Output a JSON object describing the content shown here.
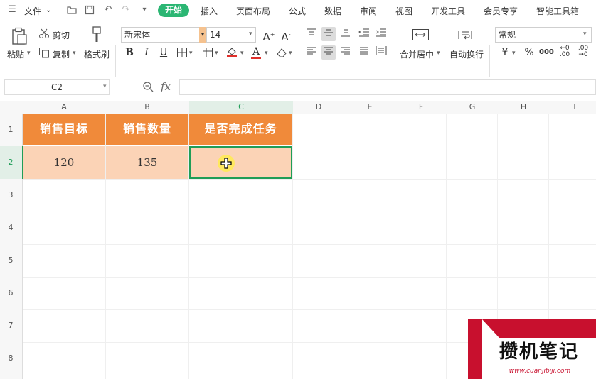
{
  "menubar": {
    "file": "文件",
    "items": [
      "开始",
      "插入",
      "页面布局",
      "公式",
      "数据",
      "审阅",
      "视图",
      "开发工具",
      "会员专享",
      "智能工具箱"
    ]
  },
  "ribbon": {
    "paste": "粘贴",
    "cut": "剪切",
    "copy": "复制",
    "format_painter": "格式刷",
    "font_name": "新宋体",
    "font_size": "14",
    "merge_center": "合并居中",
    "wrap_text": "自动换行",
    "number_format": "常规",
    "currency_symbol": "¥",
    "percent_symbol": "%",
    "thousands_symbol": "000"
  },
  "formula_bar": {
    "cell_ref": "C2",
    "fx_label": "fx",
    "formula": ""
  },
  "sheet": {
    "columns": [
      "A",
      "B",
      "C",
      "D",
      "E",
      "F",
      "G",
      "H",
      "I"
    ],
    "rows": [
      "1",
      "2",
      "3",
      "4",
      "5",
      "6",
      "7",
      "8"
    ],
    "headers": [
      "销售目标",
      "销售数量",
      "是否完成任务"
    ],
    "values": [
      "120",
      "135",
      ""
    ],
    "selected_cell": "C2"
  },
  "watermark": {
    "text": "攒机笔记",
    "url": "www.cuanjibiji.com"
  },
  "colors": {
    "accent": "#2bb673",
    "header_fill": "#f08a3a",
    "data_fill": "#fbd3b6",
    "selection": "#1f9d57",
    "watermark_red": "#c8102e"
  }
}
